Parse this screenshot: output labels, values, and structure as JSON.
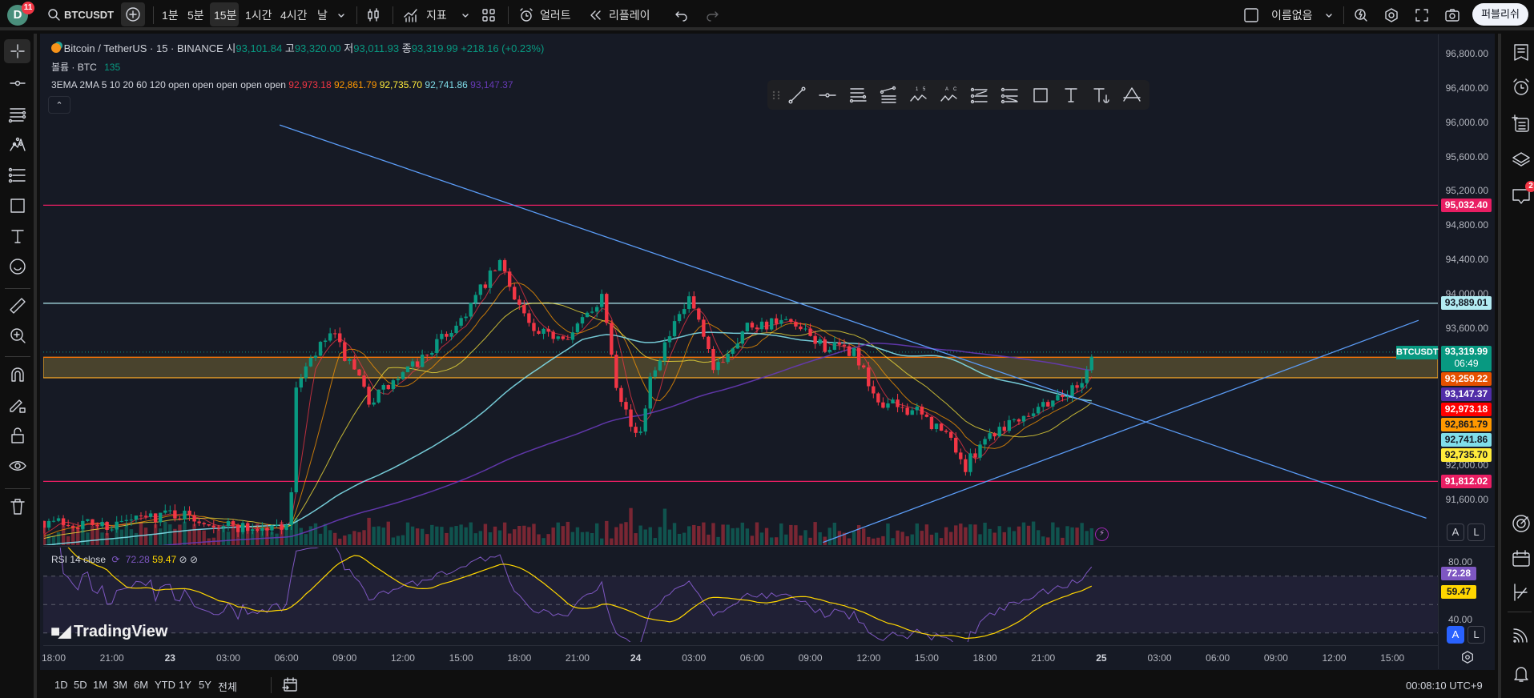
{
  "topbar": {
    "avatar_letter": "D",
    "avatar_badge": "11",
    "symbol": "BTCUSDT",
    "intervals": [
      {
        "label": "1분",
        "active": false
      },
      {
        "label": "5분",
        "active": false
      },
      {
        "label": "15분",
        "active": true
      },
      {
        "label": "1시간",
        "active": false
      },
      {
        "label": "4시간",
        "active": false
      },
      {
        "label": "날",
        "active": false
      }
    ],
    "indicators_label": "지표",
    "alert_label": "얼러트",
    "replay_label": "리플레이",
    "layout_name": "이름없음",
    "publish_label": "퍼블리쉬"
  },
  "legend": {
    "title": "Bitcoin / TetherUS · 15 · BINANCE",
    "o_label": "시",
    "o": "93,101.84",
    "h_label": "고",
    "h": "93,320.00",
    "l_label": "저",
    "l": "93,011.93",
    "c_label": "종",
    "c": "93,319.99",
    "change": "+218.16 (+0.23%)",
    "volume_label": "볼륨 · BTC",
    "volume": "135",
    "ma_label": "3EMA 2MA 5 10 20 60 120 open open open open open",
    "ma_values": [
      {
        "v": "92,973.18",
        "color": "#f23645"
      },
      {
        "v": "92,861.79",
        "color": "#ff9800"
      },
      {
        "v": "92,735.70",
        "color": "#ffeb3b"
      },
      {
        "v": "92,741.86",
        "color": "#80deea"
      },
      {
        "v": "93,147.37",
        "color": "#673ab7"
      }
    ]
  },
  "price_axis": {
    "ticks": [
      "96,800.00",
      "96,400.00",
      "96,000.00",
      "95,600.00",
      "95,200.00",
      "94,800.00",
      "94,400.00",
      "94,000.00",
      "93,600.00",
      "92,000.00",
      "91,600.00"
    ],
    "tick_values": [
      96800,
      96400,
      96000,
      95600,
      95200,
      94800,
      94400,
      94000,
      93600,
      92000,
      91600
    ],
    "level_tags": [
      {
        "text": "95,032.40",
        "price": 95032.4,
        "bg": "#e91e63",
        "fg": "#ffffff"
      },
      {
        "text": "93,889.01",
        "price": 93889.01,
        "bg": "#b2ebf2",
        "fg": "#131722"
      },
      {
        "text": "91,812.02",
        "price": 91812.02,
        "bg": "#e91e63",
        "fg": "#ffffff"
      }
    ],
    "current": {
      "price": "93,319.99",
      "countdown": "06:49",
      "symbol": "BTCUSDT",
      "bg": "#089981"
    },
    "stack_tags": [
      {
        "text": "93,259.22",
        "bg": "#e65100",
        "fg": "#fff"
      },
      {
        "text": "93,147.37",
        "bg": "#512da8",
        "fg": "#fff"
      },
      {
        "text": "92,973.18",
        "bg": "#ff0000",
        "fg": "#fff"
      },
      {
        "text": "92,861.79",
        "bg": "#ff9800",
        "fg": "#131722"
      },
      {
        "text": "92,741.86",
        "bg": "#80deea",
        "fg": "#131722"
      },
      {
        "text": "92,735.70",
        "bg": "#ffeb3b",
        "fg": "#131722"
      }
    ],
    "auto_label": "A",
    "log_label": "L"
  },
  "rsi": {
    "label": "RSI 14 close",
    "value": "72.28",
    "ma_value": "59.47",
    "ticks": [
      "80.00",
      "40.00"
    ],
    "value_color": "#7e57c2",
    "ma_color": "#ffd600",
    "auto_label": "A",
    "log_label": "L"
  },
  "time_axis": {
    "labels": [
      "18:00",
      "21:00",
      "23",
      "03:00",
      "06:00",
      "09:00",
      "12:00",
      "15:00",
      "18:00",
      "21:00",
      "24",
      "03:00",
      "06:00",
      "09:00",
      "12:00",
      "15:00",
      "18:00",
      "21:00",
      "25",
      "03:00",
      "06:00",
      "09:00",
      "12:00",
      "15:00"
    ]
  },
  "bottombar": {
    "ranges": [
      "1D",
      "5D",
      "1M",
      "3M",
      "6M",
      "YTD",
      "1Y",
      "5Y",
      "전체"
    ],
    "clock": "00:08:10 UTC+9"
  },
  "watermark": "TradingView",
  "right_badge": "2",
  "chart_data": {
    "type": "candlestick",
    "interval_minutes": 15,
    "x_unit": "hours since 22 18:00",
    "price_path": [
      [
        -0.5,
        91350
      ],
      [
        3,
        91300
      ],
      [
        6,
        91450
      ],
      [
        9,
        91300
      ],
      [
        11,
        91250
      ],
      [
        12.2,
        91350
      ],
      [
        12.5,
        92950
      ],
      [
        14.3,
        93550
      ],
      [
        16.3,
        92750
      ],
      [
        18.3,
        93100
      ],
      [
        20.8,
        93650
      ],
      [
        23,
        94350
      ],
      [
        24.8,
        93500
      ],
      [
        26.8,
        93550
      ],
      [
        28.3,
        94000
      ],
      [
        29,
        92980
      ],
      [
        30.1,
        92240
      ],
      [
        30.8,
        93100
      ],
      [
        32.8,
        93950
      ],
      [
        34,
        93100
      ],
      [
        35.8,
        93650
      ],
      [
        37.8,
        93650
      ],
      [
        39.8,
        93380
      ],
      [
        41.3,
        93320
      ],
      [
        42.3,
        92750
      ],
      [
        44.3,
        92640
      ],
      [
        46.3,
        92300
      ],
      [
        47,
        91950
      ],
      [
        47.8,
        92300
      ],
      [
        49.3,
        92520
      ],
      [
        51.3,
        92750
      ],
      [
        52.8,
        92920
      ],
      [
        53.6,
        93320
      ]
    ],
    "y_range": [
      91000,
      97000
    ],
    "horizontal_levels": [
      {
        "price": 95032.4,
        "color": "#e91e63"
      },
      {
        "price": 93889.01,
        "color": "#b2ebf2"
      },
      {
        "price": 91812.02,
        "color": "#e91e63"
      }
    ],
    "zone": {
      "from": 93020,
      "to": 93259.22,
      "color": "#ffd54f"
    },
    "trendlines": [
      {
        "from": [
          11.65,
          95968
        ],
        "to": [
          70.75,
          91383
        ],
        "color": "#5b9cf6"
      },
      {
        "from": [
          39.65,
          91100
        ],
        "to": [
          70.35,
          93690
        ],
        "color": "#5b9cf6"
      }
    ],
    "moving_averages": [
      {
        "period": 5,
        "color": "#f23645"
      },
      {
        "period": 10,
        "color": "#ff9800"
      },
      {
        "period": 20,
        "color": "#ffeb3b"
      },
      {
        "period": 60,
        "color": "#80deea"
      },
      {
        "period": 120,
        "color": "#673ab7"
      }
    ],
    "rsi_levels": [
      70,
      50,
      30
    ]
  }
}
